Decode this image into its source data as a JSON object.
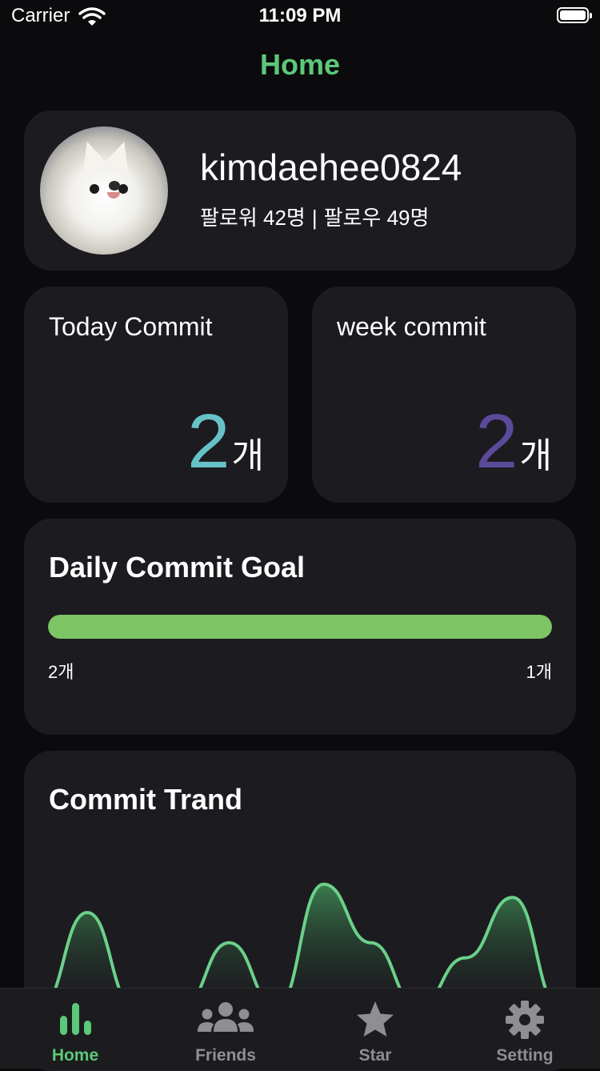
{
  "status_bar": {
    "carrier": "Carrier",
    "time": "11:09 PM"
  },
  "nav": {
    "title": "Home"
  },
  "profile": {
    "username": "kimdaehee0824",
    "followers": "팔로워 42명",
    "separator": "|",
    "following": "팔로우 49명"
  },
  "today": {
    "title": "Today Commit",
    "value": "2",
    "unit": "개"
  },
  "week": {
    "title": "week commit",
    "value": "2",
    "unit": "개"
  },
  "goal": {
    "title": "Daily Commit Goal",
    "left_label": "2개",
    "right_label": "1개",
    "progress": 1.0
  },
  "trend": {
    "title": "Commit Trand",
    "values": [
      0,
      1.0,
      0,
      0,
      0.68,
      0,
      1.3,
      0.68,
      0,
      0.52,
      1.16,
      0
    ]
  },
  "colors": {
    "accent": "#5cc87a",
    "today_value": "#66c2c6",
    "week_value": "#5b4a9a",
    "progress": "#7dc465",
    "trend_line": "#6bd08a",
    "tab_active": "#5cc87a",
    "tab_inactive": "#8e8e93"
  },
  "tabs": [
    {
      "label": "Home",
      "icon": "bar-chart-icon",
      "active": true
    },
    {
      "label": "Friends",
      "icon": "people-icon",
      "active": false
    },
    {
      "label": "Star",
      "icon": "star-icon",
      "active": false
    },
    {
      "label": "Setting",
      "icon": "gear-icon",
      "active": false
    }
  ]
}
